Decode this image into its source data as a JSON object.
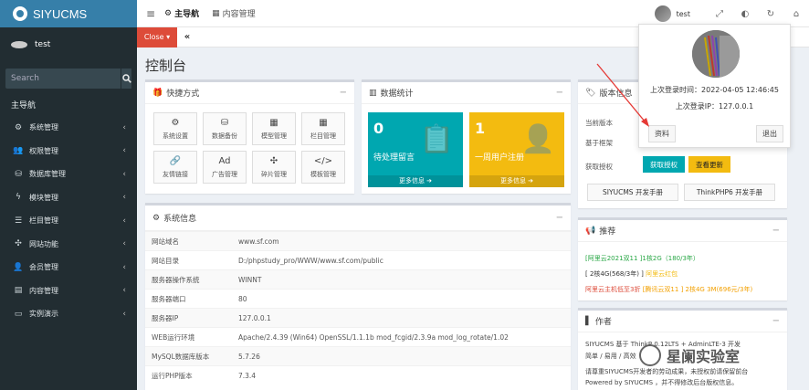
{
  "brand": {
    "name": "SIYUCMS"
  },
  "sidebar": {
    "user": "test",
    "search_placeholder": "Search",
    "menu_header": "主导航",
    "items": [
      {
        "label": "系统管理",
        "icon": "gears-icon",
        "glyph": "⚙"
      },
      {
        "label": "权限管理",
        "icon": "users-icon",
        "glyph": "👥"
      },
      {
        "label": "数据库管理",
        "icon": "database-icon",
        "glyph": "⛁"
      },
      {
        "label": "模块管理",
        "icon": "bolt-icon",
        "glyph": "ϟ"
      },
      {
        "label": "栏目管理",
        "icon": "list-icon",
        "glyph": "☰"
      },
      {
        "label": "网站功能",
        "icon": "puzzle-icon",
        "glyph": "✣"
      },
      {
        "label": "会员管理",
        "icon": "user-icon",
        "glyph": "👤"
      },
      {
        "label": "内容管理",
        "icon": "file-icon",
        "glyph": "▤"
      },
      {
        "label": "实例演示",
        "icon": "desktop-icon",
        "glyph": "▭"
      }
    ]
  },
  "header": {
    "tabs": [
      {
        "label": "主导航"
      },
      {
        "label": "内容管理"
      }
    ],
    "user": "test"
  },
  "tabbar": {
    "close_label": "Close"
  },
  "page": {
    "title": "控制台"
  },
  "shortcuts": {
    "title": "快捷方式",
    "items": [
      {
        "label": "系统设置",
        "glyph": "⚙"
      },
      {
        "label": "数据备份",
        "glyph": "⛁"
      },
      {
        "label": "模型管理",
        "glyph": "▦"
      },
      {
        "label": "栏目管理",
        "glyph": "▦"
      },
      {
        "label": "友情链接",
        "glyph": "🔗"
      },
      {
        "label": "广告管理",
        "glyph": "Ad"
      },
      {
        "label": "碎片管理",
        "glyph": "✣"
      },
      {
        "label": "模板管理",
        "glyph": "</>"
      }
    ]
  },
  "stats": {
    "title": "数据统计",
    "cards": [
      {
        "count": "0",
        "label": "待处理留言",
        "more": "更多信息",
        "color": "#00a7b0"
      },
      {
        "count": "1",
        "label": "一周用户注册",
        "more": "更多信息",
        "color": "#f3bb10"
      }
    ]
  },
  "version": {
    "title": "版本信息",
    "rows": [
      "当前版本",
      "基于框架",
      "获取授权"
    ],
    "authorize_label": "获取授权",
    "update_label": "查看更新",
    "manual_siyucms": "SIYUCMS 开发手册",
    "manual_thinkphp": "ThinkPHP6 开发手册"
  },
  "sysinfo": {
    "title": "系统信息",
    "rows": [
      {
        "k": "网站域名",
        "v": "www.sf.com"
      },
      {
        "k": "网站目录",
        "v": "D:/phpstudy_pro/WWW/www.sf.com/public"
      },
      {
        "k": "服务器操作系统",
        "v": "WINNT"
      },
      {
        "k": "服务器端口",
        "v": "80"
      },
      {
        "k": "服务器IP",
        "v": "127.0.0.1"
      },
      {
        "k": "WEB运行环境",
        "v": "Apache/2.4.39 (Win64) OpenSSL/1.1.1b mod_fcgid/2.3.9a mod_log_rotate/1.02"
      },
      {
        "k": "MySQL数据库版本",
        "v": "5.7.26"
      },
      {
        "k": "运行PHP版本",
        "v": "7.3.4"
      }
    ]
  },
  "recommend": {
    "title": "推荐",
    "line1": "[阿里云2021双11 ]1核2G（180/3年）",
    "line2a": "[ 2核4G(568/3年) ]",
    "line2b": "阿里云红包",
    "line3a": "阿里云主机低至3折",
    "line3b": "[腾讯云双11 ] 2核4G 3M(696元/3年)"
  },
  "author": {
    "title": "作者",
    "line1": "SIYUCMS 基于 ThinkP",
    "line1b": "0.12LTS + AdminLTE-3 开发",
    "line2": "简单 / 易用 / 高效",
    "line3": "请尊重SIYUCMS开发者的劳动成果，未授权前请保留前台",
    "line4": "Powered by SIYUCMS ，并不得修改后台版权信息。"
  },
  "popup": {
    "last_login_time": "上次登录时间：2022-04-05 12:46:45",
    "last_login_ip": "上次登录IP：127.0.0.1",
    "profile_label": "资料",
    "logout_label": "退出"
  },
  "watermark": {
    "text": "星阑实验室"
  }
}
